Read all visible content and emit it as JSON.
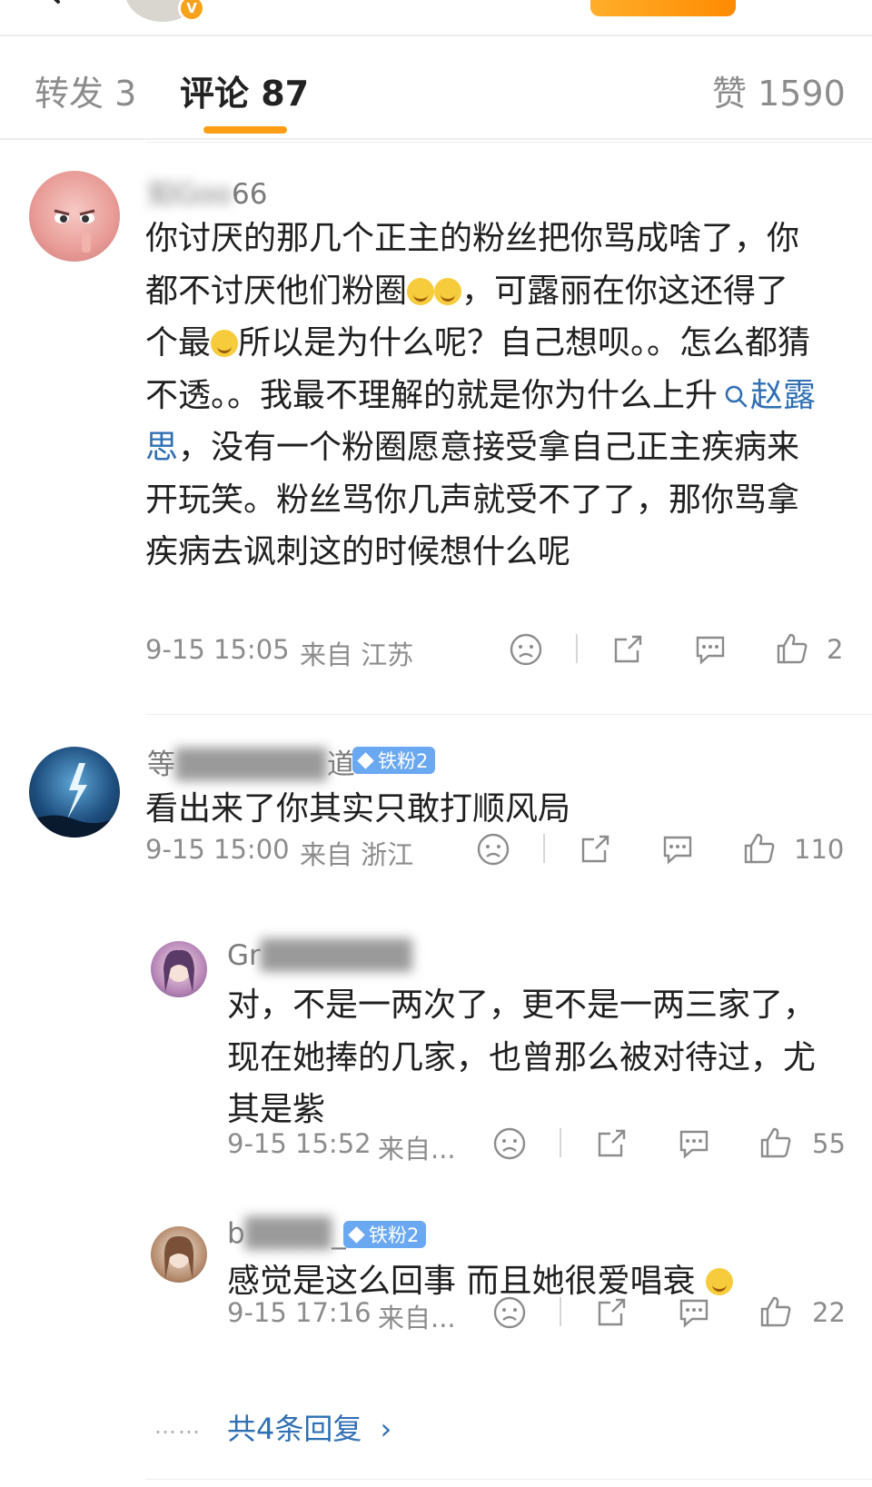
{
  "tabs": {
    "repost": "转发 3",
    "comments": "评论 87",
    "likes": "赞 1590"
  },
  "comments": [
    {
      "username_visible_prefix": "如Goo",
      "username_visible_suffix": "66",
      "content_1": "你讨厌的那几个正主的粉丝把你骂成啥了，你都不讨厌他们粉圈",
      "content_2": "，可露丽在你这还得了个最",
      "content_3": "所以是为什么呢？自己想呗。。怎么都猜不透。。我最不理解的就是你为什么上升",
      "topic": "赵露思",
      "content_4": "，没有一个粉圈愿意接受拿自己正主疾病来开玩笑。粉丝骂你几声就受不了了，那你骂拿疾病去讽刺这的时候想什么呢",
      "time": "9-15 15:05",
      "location": "来自 江苏",
      "likes": "2"
    },
    {
      "username_visible_prefix": "等",
      "username_visible_suffix": "道",
      "badge": "铁粉2",
      "content": "看出来了你其实只敢打顺风局",
      "time": "9-15 15:00",
      "location": "来自 浙江",
      "likes": "110"
    }
  ],
  "replies": [
    {
      "username_visible_prefix": "Gr",
      "content": "对，不是一两次了，更不是一两三家了，现在她捧的几家，也曾那么被对待过，尤其是紫",
      "time": "9-15 15:52",
      "location": "来自...",
      "likes": "55"
    },
    {
      "username_visible_prefix": "b",
      "username_visible_suffix": "_",
      "badge": "铁粉2",
      "content": "感觉是这么回事 而且她很爱唱衰",
      "time": "9-15 17:16",
      "location": "来自...",
      "likes": "22"
    }
  ],
  "more": {
    "dots": "……",
    "label": "共4条回复",
    "arrow": "›"
  },
  "icon_names": [
    "back-arrow-icon",
    "verified-v-icon",
    "dislike-face-icon",
    "share-icon",
    "comment-icon",
    "thumbs-up-icon",
    "diamond-badge-icon",
    "search-topic-icon",
    "crying-laugh-emoji-icon"
  ],
  "colors": {
    "accent_orange": "#ff9e14",
    "link_blue": "#2f6fb3",
    "badge_blue": "#6aa8f2",
    "meta_gray": "#8c8c8c"
  }
}
